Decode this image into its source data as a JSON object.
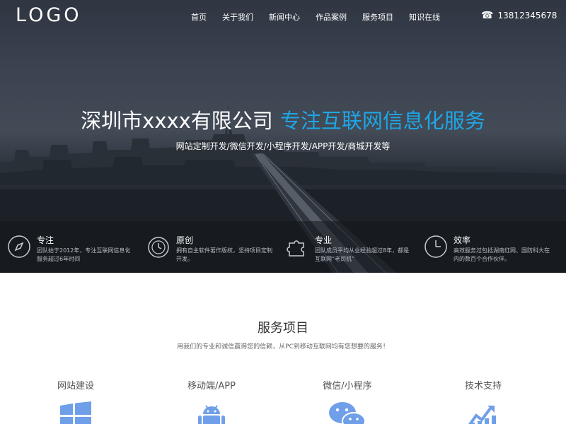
{
  "header": {
    "logo": "LOGO",
    "nav": [
      "首页",
      "关于我们",
      "新闻中心",
      "作品案例",
      "服务项目",
      "知识在线"
    ],
    "phone": "13812345678",
    "phone_icon": "phone-icon"
  },
  "hero": {
    "title_main": "深圳市xxxx有限公司",
    "title_accent": "专注互联网信息化服务",
    "subtitle": "网站定制开发/微信开发/小程序开发/APP开发/商城开发等",
    "accent_color": "#1ea6e6"
  },
  "features": [
    {
      "icon": "compass-icon",
      "title": "专注",
      "desc": "团队始于2012年，专注互联网信息化服务超过6年时间"
    },
    {
      "icon": "stopwatch-icon",
      "title": "原创",
      "desc": "拥有自主软件著作版权，坚持项目定制开发。"
    },
    {
      "icon": "puzzle-icon",
      "title": "专业",
      "desc": "团队成员平均从业经验超过8年，都是互联网“老司机”"
    },
    {
      "icon": "clock-icon",
      "title": "效率",
      "desc": "高效服务过包括湖南红网、国防科大在内的数百个合作伙伴。"
    }
  ],
  "services": {
    "title": "服务项目",
    "subtitle": "用我们的专业和诚信赢得您的信赖，从PC到移动互联网均有您想要的服务！",
    "items": [
      {
        "label": "网站建设",
        "icon": "windows-icon"
      },
      {
        "label": "移动端/APP",
        "icon": "android-icon"
      },
      {
        "label": "微信/小程序",
        "icon": "wechat-icon"
      },
      {
        "label": "技术支持",
        "icon": "chart-icon"
      }
    ],
    "icon_color": "#6f9fe9"
  }
}
